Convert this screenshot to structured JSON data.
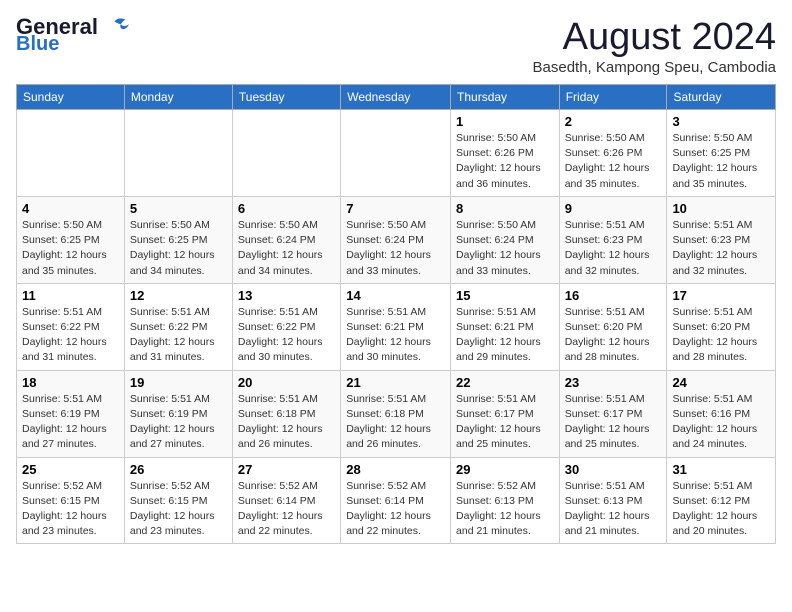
{
  "header": {
    "logo_line1": "General",
    "logo_line2": "Blue",
    "month_title": "August 2024",
    "subtitle": "Basedth, Kampong Speu, Cambodia"
  },
  "weekdays": [
    "Sunday",
    "Monday",
    "Tuesday",
    "Wednesday",
    "Thursday",
    "Friday",
    "Saturday"
  ],
  "weeks": [
    [
      {
        "day": "",
        "info": ""
      },
      {
        "day": "",
        "info": ""
      },
      {
        "day": "",
        "info": ""
      },
      {
        "day": "",
        "info": ""
      },
      {
        "day": "1",
        "info": "Sunrise: 5:50 AM\nSunset: 6:26 PM\nDaylight: 12 hours\nand 36 minutes."
      },
      {
        "day": "2",
        "info": "Sunrise: 5:50 AM\nSunset: 6:26 PM\nDaylight: 12 hours\nand 35 minutes."
      },
      {
        "day": "3",
        "info": "Sunrise: 5:50 AM\nSunset: 6:25 PM\nDaylight: 12 hours\nand 35 minutes."
      }
    ],
    [
      {
        "day": "4",
        "info": "Sunrise: 5:50 AM\nSunset: 6:25 PM\nDaylight: 12 hours\nand 35 minutes."
      },
      {
        "day": "5",
        "info": "Sunrise: 5:50 AM\nSunset: 6:25 PM\nDaylight: 12 hours\nand 34 minutes."
      },
      {
        "day": "6",
        "info": "Sunrise: 5:50 AM\nSunset: 6:24 PM\nDaylight: 12 hours\nand 34 minutes."
      },
      {
        "day": "7",
        "info": "Sunrise: 5:50 AM\nSunset: 6:24 PM\nDaylight: 12 hours\nand 33 minutes."
      },
      {
        "day": "8",
        "info": "Sunrise: 5:50 AM\nSunset: 6:24 PM\nDaylight: 12 hours\nand 33 minutes."
      },
      {
        "day": "9",
        "info": "Sunrise: 5:51 AM\nSunset: 6:23 PM\nDaylight: 12 hours\nand 32 minutes."
      },
      {
        "day": "10",
        "info": "Sunrise: 5:51 AM\nSunset: 6:23 PM\nDaylight: 12 hours\nand 32 minutes."
      }
    ],
    [
      {
        "day": "11",
        "info": "Sunrise: 5:51 AM\nSunset: 6:22 PM\nDaylight: 12 hours\nand 31 minutes."
      },
      {
        "day": "12",
        "info": "Sunrise: 5:51 AM\nSunset: 6:22 PM\nDaylight: 12 hours\nand 31 minutes."
      },
      {
        "day": "13",
        "info": "Sunrise: 5:51 AM\nSunset: 6:22 PM\nDaylight: 12 hours\nand 30 minutes."
      },
      {
        "day": "14",
        "info": "Sunrise: 5:51 AM\nSunset: 6:21 PM\nDaylight: 12 hours\nand 30 minutes."
      },
      {
        "day": "15",
        "info": "Sunrise: 5:51 AM\nSunset: 6:21 PM\nDaylight: 12 hours\nand 29 minutes."
      },
      {
        "day": "16",
        "info": "Sunrise: 5:51 AM\nSunset: 6:20 PM\nDaylight: 12 hours\nand 28 minutes."
      },
      {
        "day": "17",
        "info": "Sunrise: 5:51 AM\nSunset: 6:20 PM\nDaylight: 12 hours\nand 28 minutes."
      }
    ],
    [
      {
        "day": "18",
        "info": "Sunrise: 5:51 AM\nSunset: 6:19 PM\nDaylight: 12 hours\nand 27 minutes."
      },
      {
        "day": "19",
        "info": "Sunrise: 5:51 AM\nSunset: 6:19 PM\nDaylight: 12 hours\nand 27 minutes."
      },
      {
        "day": "20",
        "info": "Sunrise: 5:51 AM\nSunset: 6:18 PM\nDaylight: 12 hours\nand 26 minutes."
      },
      {
        "day": "21",
        "info": "Sunrise: 5:51 AM\nSunset: 6:18 PM\nDaylight: 12 hours\nand 26 minutes."
      },
      {
        "day": "22",
        "info": "Sunrise: 5:51 AM\nSunset: 6:17 PM\nDaylight: 12 hours\nand 25 minutes."
      },
      {
        "day": "23",
        "info": "Sunrise: 5:51 AM\nSunset: 6:17 PM\nDaylight: 12 hours\nand 25 minutes."
      },
      {
        "day": "24",
        "info": "Sunrise: 5:51 AM\nSunset: 6:16 PM\nDaylight: 12 hours\nand 24 minutes."
      }
    ],
    [
      {
        "day": "25",
        "info": "Sunrise: 5:52 AM\nSunset: 6:15 PM\nDaylight: 12 hours\nand 23 minutes."
      },
      {
        "day": "26",
        "info": "Sunrise: 5:52 AM\nSunset: 6:15 PM\nDaylight: 12 hours\nand 23 minutes."
      },
      {
        "day": "27",
        "info": "Sunrise: 5:52 AM\nSunset: 6:14 PM\nDaylight: 12 hours\nand 22 minutes."
      },
      {
        "day": "28",
        "info": "Sunrise: 5:52 AM\nSunset: 6:14 PM\nDaylight: 12 hours\nand 22 minutes."
      },
      {
        "day": "29",
        "info": "Sunrise: 5:52 AM\nSunset: 6:13 PM\nDaylight: 12 hours\nand 21 minutes."
      },
      {
        "day": "30",
        "info": "Sunrise: 5:51 AM\nSunset: 6:13 PM\nDaylight: 12 hours\nand 21 minutes."
      },
      {
        "day": "31",
        "info": "Sunrise: 5:51 AM\nSunset: 6:12 PM\nDaylight: 12 hours\nand 20 minutes."
      }
    ]
  ]
}
